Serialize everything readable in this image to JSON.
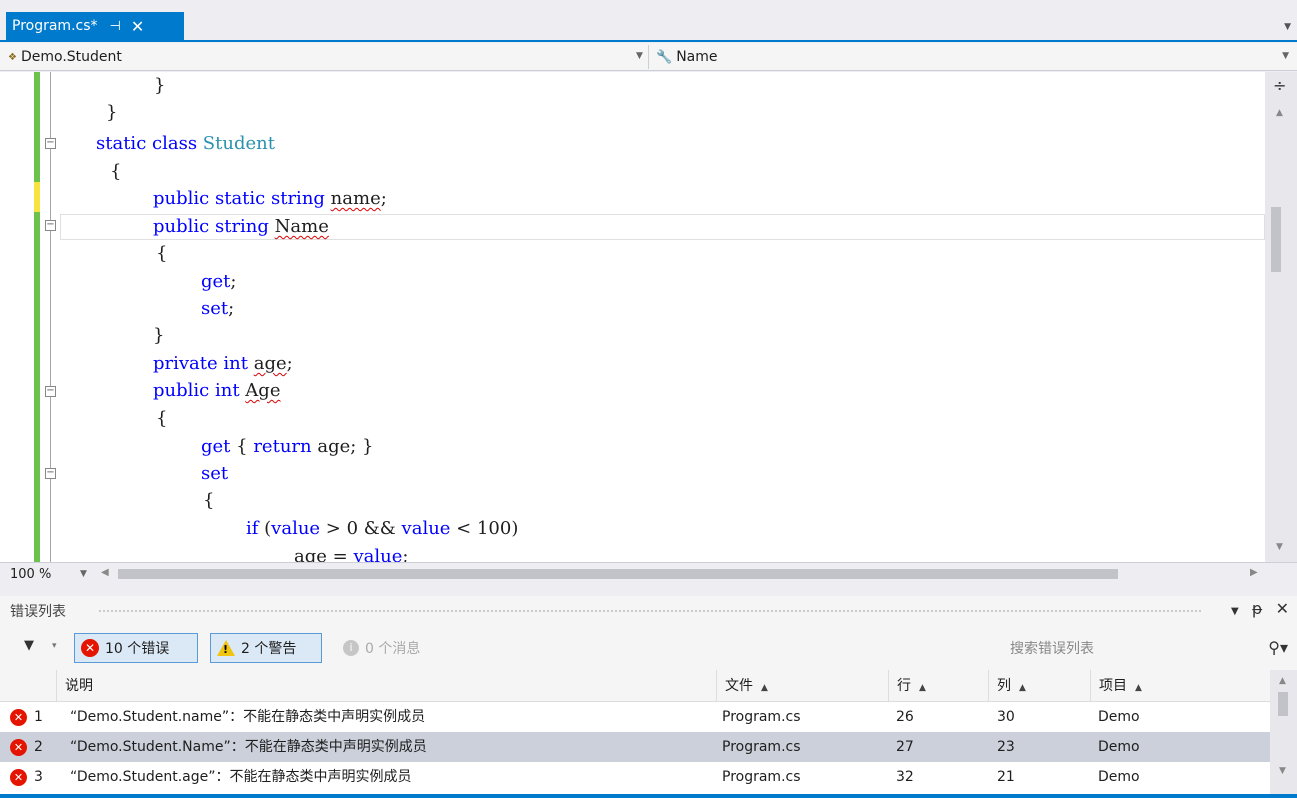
{
  "tab": {
    "title": "Program.cs*",
    "pin": "⊣",
    "close": "✕"
  },
  "nav": {
    "type_member": "Demo.Student",
    "member": "Name"
  },
  "code_lines": [
    "}",
    "}",
    "static class Student",
    "{",
    "public static string name;",
    "public string Name",
    "{",
    "get;",
    "set;",
    "}",
    "private int age;",
    "public int Age",
    "{",
    "get { return age; }",
    "set",
    "{",
    "if (value > 0 && value < 100)",
    "age = value;"
  ],
  "zoom": "100 %",
  "error_list": {
    "title": "错误列表",
    "errors_btn": "10 个错误",
    "warnings_btn": "2 个警告",
    "messages_btn": "0 个消息",
    "search_placeholder": "搜索错误列表",
    "columns": {
      "desc": "说明",
      "file": "文件",
      "line": "行",
      "col": "列",
      "project": "项目"
    },
    "rows": [
      {
        "num": "1",
        "desc": "“Demo.Student.name”：不能在静态类中声明实例成员",
        "file": "Program.cs",
        "line": "26",
        "col": "30",
        "project": "Demo"
      },
      {
        "num": "2",
        "desc": "“Demo.Student.Name”：不能在静态类中声明实例成员",
        "file": "Program.cs",
        "line": "27",
        "col": "23",
        "project": "Demo"
      },
      {
        "num": "3",
        "desc": "“Demo.Student.age”：不能在静态类中声明实例成员",
        "file": "Program.cs",
        "line": "32",
        "col": "21",
        "project": "Demo"
      }
    ]
  },
  "colors": {
    "accent": "#007acc",
    "keyword": "#0000ff",
    "type": "#2b91af",
    "error": "#e51400"
  }
}
